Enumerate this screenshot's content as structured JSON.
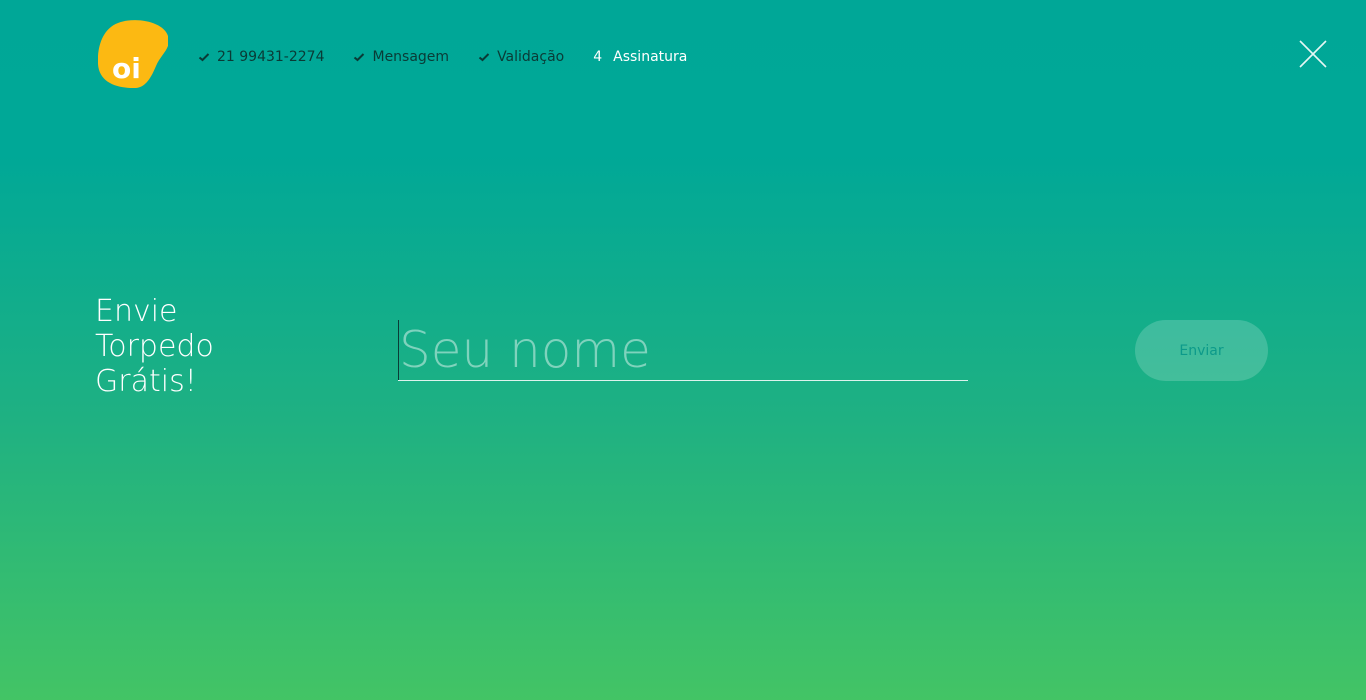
{
  "brand": {
    "logo_text": "oi",
    "logo_color": "#fcb912"
  },
  "steps": [
    {
      "label": "21 99431-2274",
      "status": "done",
      "icon": "check-icon"
    },
    {
      "label": "Mensagem",
      "status": "done",
      "icon": "check-icon"
    },
    {
      "label": "Validação",
      "status": "done",
      "icon": "check-icon"
    },
    {
      "number": "4",
      "label": "Assinatura",
      "status": "current"
    }
  ],
  "close": {
    "icon": "close-icon"
  },
  "headline": {
    "line1": "Envie",
    "line2": "Torpedo",
    "line3": "Grátis!"
  },
  "form": {
    "name_placeholder": "Seu nome",
    "name_value": "",
    "submit_label": "Enviar"
  },
  "colors": {
    "gradient_top": "#00a797",
    "gradient_bottom": "#43c465",
    "step_done_text": "#0a3b36",
    "step_current_text": "#ffffff"
  }
}
